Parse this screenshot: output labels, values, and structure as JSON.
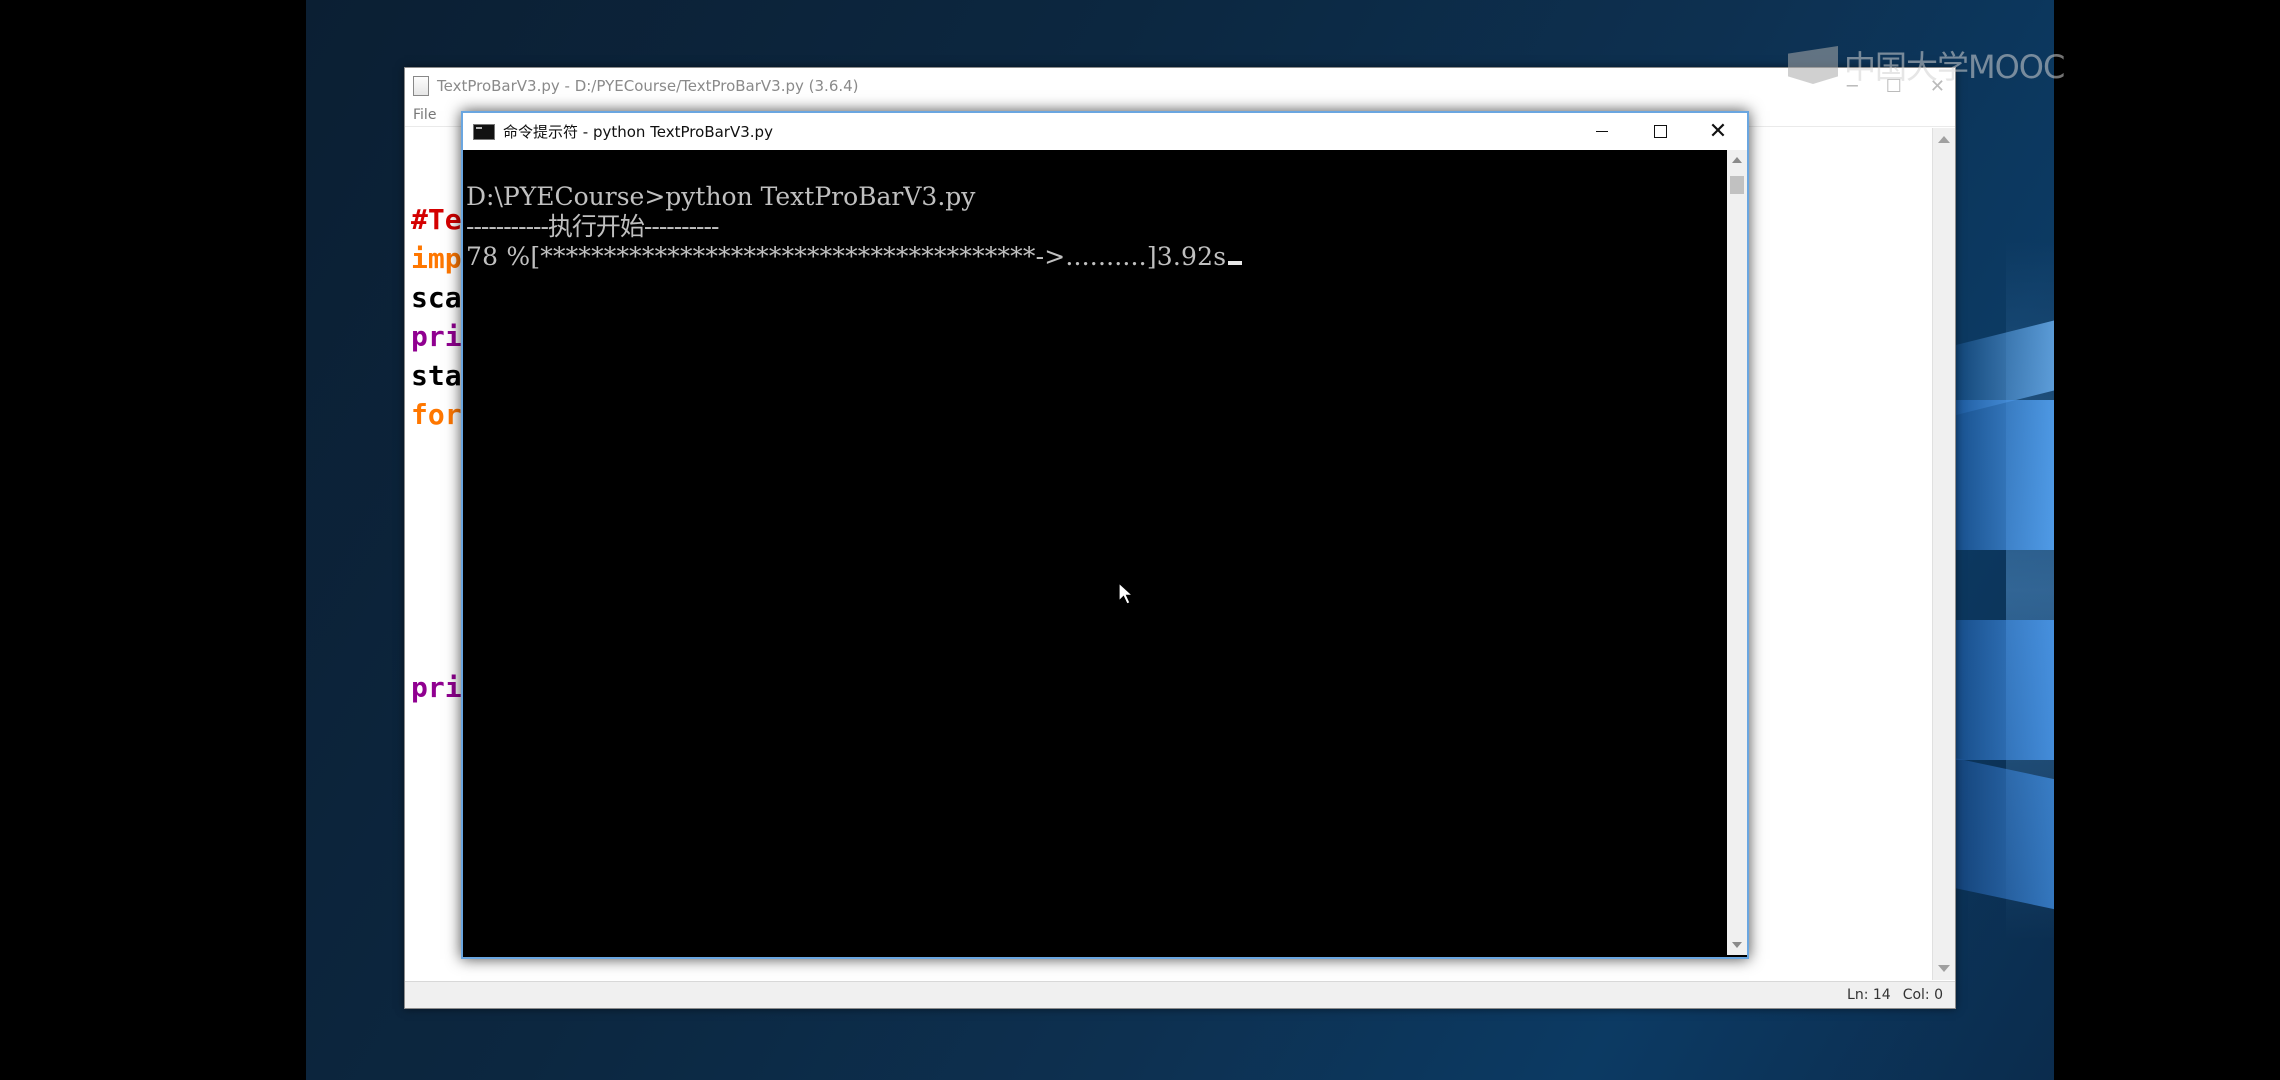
{
  "watermark": {
    "text": "中国大学MOOC"
  },
  "idle_window": {
    "title": "TextProBarV3.py - D:/PYECourse/TextProBarV3.py (3.6.4)",
    "menu": [
      "File"
    ],
    "code_lines": [
      {
        "text": "#Te",
        "color": "#d40000"
      },
      {
        "text": "imp",
        "color": "#ff7700"
      },
      {
        "text": "sca",
        "color": "#000000"
      },
      {
        "text": "pri",
        "color": "#900090"
      },
      {
        "text": "sta",
        "color": "#000000"
      },
      {
        "text": "for",
        "color": "#ff7700"
      },
      {
        "text": "pri",
        "color": "#900090"
      }
    ],
    "status": {
      "line": "Ln: 14",
      "col": "Col: 0"
    }
  },
  "cmd_window": {
    "title": "命令提示符 - python  TextProBarV3.py",
    "lines": [
      "D:\\PYECourse>python TextProBarV3.py",
      "-----------执行开始----------",
      "78 %[***************************************->..........]3.92s"
    ]
  },
  "colors": {
    "cmd_border": "#6aa6e0",
    "cmd_text": "#c0c0c0",
    "desktop_blue": "#0c3a63"
  },
  "icons": [
    "file-icon",
    "cmd-icon",
    "minimize-icon",
    "maximize-icon",
    "close-icon",
    "mouse-pointer-icon"
  ]
}
